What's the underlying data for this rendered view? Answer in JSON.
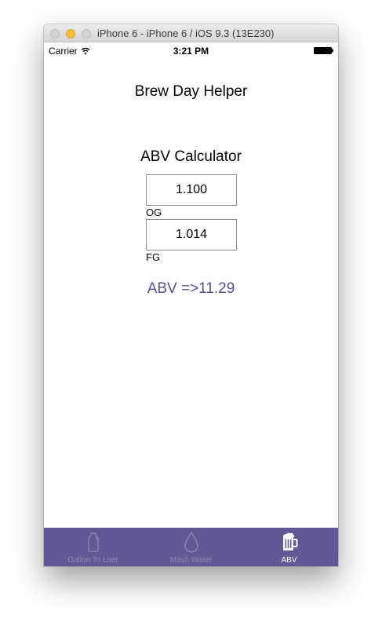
{
  "window": {
    "title": "iPhone 6 - iPhone 6 / iOS 9.3 (13E230)"
  },
  "status_bar": {
    "carrier": "Carrier",
    "time": "3:21 PM"
  },
  "app": {
    "title": "Brew Day Helper",
    "section_title": "ABV Calculator",
    "og": {
      "value": "1.100",
      "label": "OG"
    },
    "fg": {
      "value": "1.014",
      "label": "FG"
    },
    "result": "ABV =>11.29"
  },
  "tab_bar": {
    "items": [
      {
        "label": "Gallon To Liter",
        "icon": "jug-icon",
        "active": false
      },
      {
        "label": "Mash Water",
        "icon": "water-drop-icon",
        "active": false
      },
      {
        "label": "ABV",
        "icon": "beer-mug-icon",
        "active": true
      }
    ]
  },
  "colors": {
    "accent": "#625895",
    "result_text": "#5a4f91",
    "tab_inactive": "#8f88b3",
    "tab_active": "#ffffff"
  }
}
